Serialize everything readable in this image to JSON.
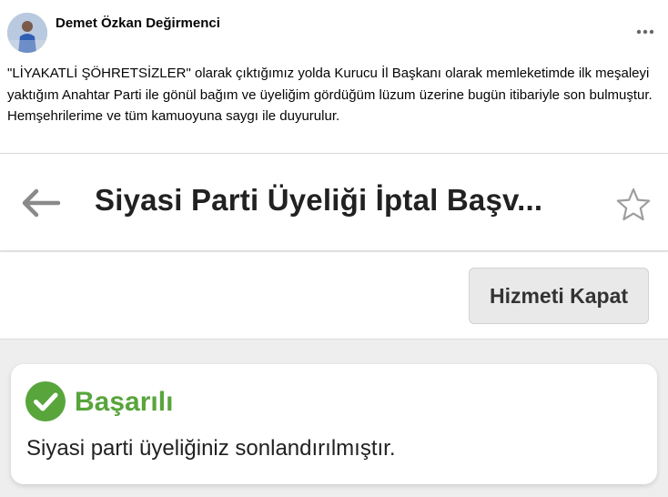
{
  "post": {
    "author": "Demet Özkan Değirmenci",
    "more_icon": "ellipsis-icon",
    "text_lines": [
      "\"LİYAKATLİ ŞÖHRETSİZLER\" olarak çıktığımız yolda Kurucu İl Başkanı olarak memleketimde ilk meşaleyi yaktığım Anahtar Parti ile gönül bağım ve üyeliğim gördüğüm lüzum üzerine bugün itibariyle son bulmuştur.",
      "Hemşehrilerime ve tüm kamuoyuna saygı ile duyurulur."
    ]
  },
  "app": {
    "title": "Siyasi Parti Üyeliği İptal Başv...",
    "back_icon": "arrow-left-icon",
    "favorite_icon": "star-outline-icon",
    "close_service_label": "Hizmeti Kapat"
  },
  "result": {
    "status_icon": "check-circle-icon",
    "title": "Başarılı",
    "message": "Siyasi parti üyeliğiniz sonlandırılmıştır.",
    "color": "#58a53c"
  }
}
